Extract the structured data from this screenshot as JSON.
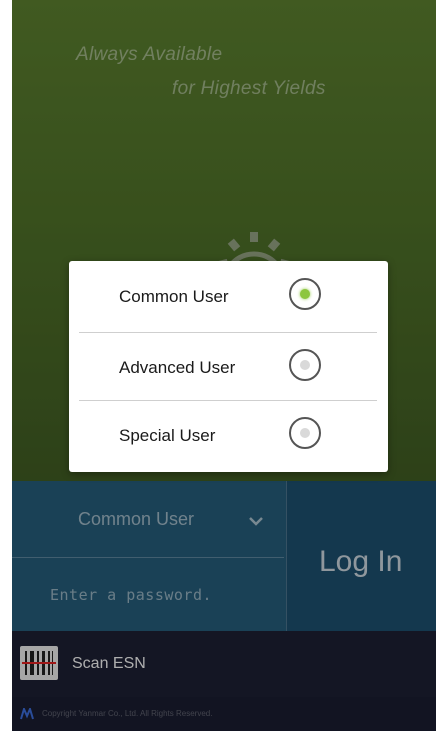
{
  "hero": {
    "slogan_line1": "Always Available",
    "slogan_line2": "for Highest Yields"
  },
  "login": {
    "user_type": "Common User",
    "password_placeholder": "Enter a password.",
    "login_button": "Log In"
  },
  "bottom": {
    "scan_label": "Scan ESN",
    "footer_text": "Copyright Yanmar Co., Ltd. All Rights Reserved."
  },
  "dialog": {
    "options": [
      {
        "label": "Common User",
        "selected": true
      },
      {
        "label": "Advanced User",
        "selected": false
      },
      {
        "label": "Special User",
        "selected": false
      }
    ]
  },
  "colors": {
    "accent_green": "#8dc63f",
    "login_blue": "#245a78",
    "bottom_bar": "#1c1f33"
  },
  "icons": [
    "gear-icon",
    "chevron-down-icon",
    "barcode-icon",
    "logo-icon"
  ]
}
